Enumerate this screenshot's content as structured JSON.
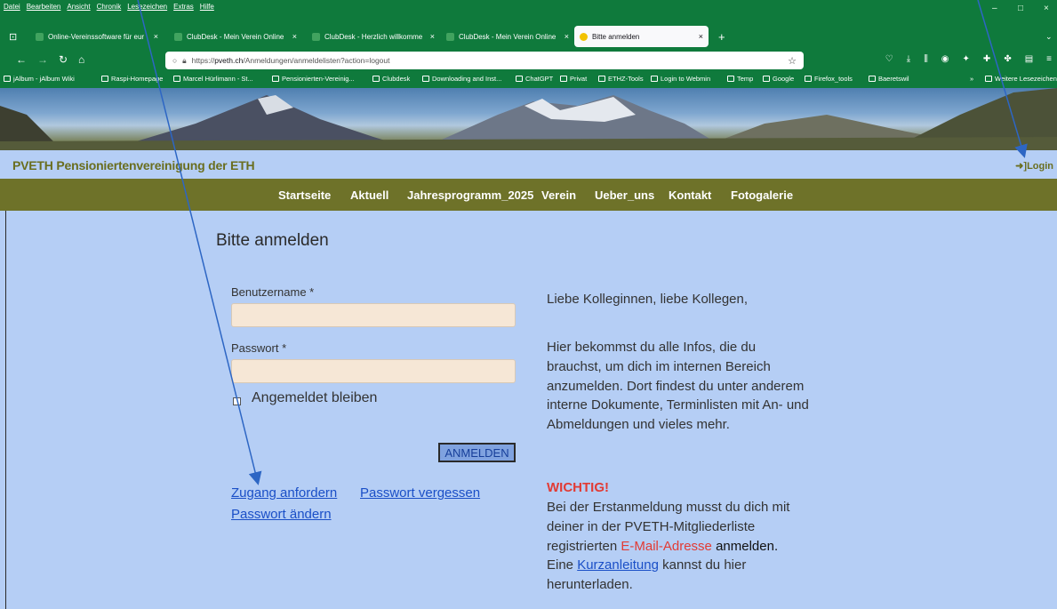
{
  "menu": [
    "Datei",
    "Bearbeiten",
    "Ansicht",
    "Chronik",
    "Lesezeichen",
    "Extras",
    "Hilfe"
  ],
  "tabs": [
    {
      "label": "Online-Vereinssoftware für eur",
      "close": "×"
    },
    {
      "label": "ClubDesk - Mein Verein Online",
      "close": "×"
    },
    {
      "label": "ClubDesk - Herzlich willkomme",
      "close": "×"
    },
    {
      "label": "ClubDesk - Mein Verein Online",
      "close": "×"
    },
    {
      "label": "Bitte anmelden",
      "close": "×"
    }
  ],
  "new_tab": "+",
  "url": {
    "prefix": "https://",
    "host": "pveth.ch",
    "path": "/Anmeldungen/anmeldelisten?action=logout"
  },
  "bookmarks": [
    "jAlbum - jAlbum Wiki",
    "Raspi-Homepage",
    "Marcel Hürlimann - St...",
    "Pensionierten-Vereinig...",
    "Clubdesk",
    "Downloading and Inst...",
    "ChatGPT",
    "Privat",
    "ETHZ-Tools",
    "Login to Webmin",
    "Temp",
    "Google",
    "Firefox_tools",
    "Baeretswil"
  ],
  "bookmarks_more": "»",
  "bookmarks_other": "Weitere Lesezeichen",
  "site": {
    "title": "PVETH Pensioniertenvereinigung der ETH",
    "login": "Login",
    "nav": [
      "Startseite",
      "Aktuell",
      "Jahresprogramm_2025",
      "Verein",
      "Ueber_uns",
      "Kontakt",
      "Fotogalerie"
    ]
  },
  "form": {
    "heading": "Bitte anmelden",
    "username_label": "Benutzername *",
    "username_value": "",
    "password_label": "Passwort *",
    "password_value": "",
    "remember_label": "Angemeldet bleiben",
    "submit": "ANMELDEN",
    "request_access": "Zugang anfordern",
    "forgot_password": "Passwort vergessen",
    "change_password": "Passwort ändern"
  },
  "info": {
    "greeting": "Liebe Kolleginnen, liebe Kollegen,",
    "body_lines": [
      "Hier bekommst du alle Infos, die du",
      "brauchst, um dich im internen Bereich",
      "anzumelden. Dort findest du unter anderem",
      "interne Dokumente, Terminlisten mit An- und",
      "Abmeldungen und vieles mehr."
    ],
    "important_heading": "WICHTIG!",
    "important_line1": "Bei der Erstanmeldung musst du dich mit",
    "important_line2": "deiner in der PVETH-Mitgliederliste",
    "important_line3_pre": "registrierten ",
    "important_line3_red": "E-Mail-Adresse",
    "important_line3_post": " anmelden.",
    "guide_pre": "Eine ",
    "guide_link": "Kurzanleitung",
    "guide_post": " kannst du hier",
    "guide_line2": "herunterladen."
  },
  "colors": {
    "browser_green": "#0f7a3c",
    "page_bg": "#b5cef5",
    "nav_olive": "#6e7229",
    "title_olive": "#6a6e1f",
    "link_blue": "#1a4fc7",
    "warning_red": "#e23b34",
    "field_bg": "#f6e7d6"
  }
}
